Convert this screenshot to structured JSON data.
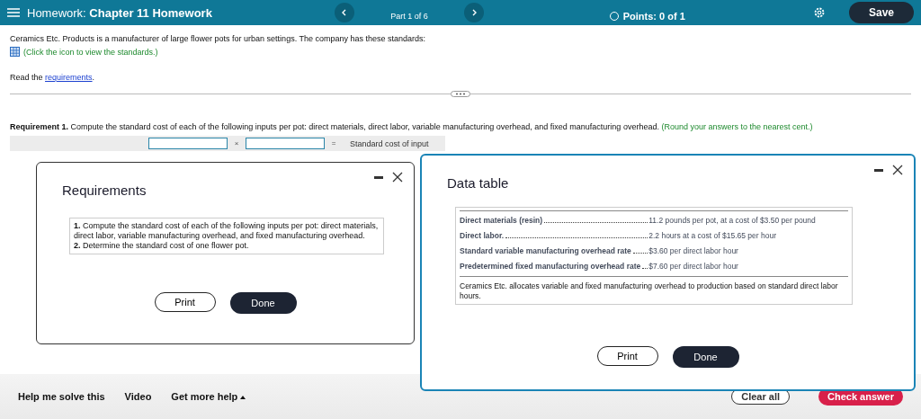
{
  "header": {
    "title_prefix": "Homework:",
    "title": "Chapter 11 Homework",
    "part": "Part 1 of 6",
    "points": "Points: 0 of 1",
    "save": "Save"
  },
  "intro": {
    "text": "Ceramics Etc. Products is a manufacturer of large flower pots for urban settings. The company has these standards:",
    "hint": "(Click the icon to view the standards.)",
    "read_before": "Read the ",
    "read_link": "requirements",
    "read_after": "."
  },
  "requirement": {
    "text": "**Requirement 1.** Compute the standard cost of each of the following inputs per pot: direct materials, direct labor, variable manufacturing overhead, and fixed manufacturing overhead.",
    "hint": "(Round your answers to the nearest cent.)",
    "times": "×",
    "equals": "=",
    "result_label": "Standard cost of input"
  },
  "requirements_dialog": {
    "title": "Requirements",
    "items": [
      "**1.** Compute the standard cost of each of the following inputs per pot: direct materials, direct labor, variable manufacturing overhead, and fixed manufacturing overhead.",
      "**2.** Determine the standard cost of one flower pot."
    ],
    "print": "Print",
    "done": "Done"
  },
  "data_dialog": {
    "title": "Data table",
    "rows": [
      {
        "label": "Direct materials (resin)",
        "value": "11.2 pounds per pot, at a cost of $3.50 per pound"
      },
      {
        "label": "Direct labor.",
        "value": "2.2 hours at a cost of $15.65 per hour"
      },
      {
        "label": "Standard variable manufacturing overhead rate",
        "value": "$3.60 per direct labor hour"
      },
      {
        "label": "Predetermined fixed manufacturing overhead rate",
        "value": "$7.60 per direct labor hour"
      }
    ],
    "note": "Ceramics Etc. allocates variable and fixed manufacturing overhead to production based on standard direct labor hours.",
    "print": "Print",
    "done": "Done"
  },
  "footer": {
    "help": "Help me solve this",
    "video": "Video",
    "more": "Get more help",
    "clear": "Clear all",
    "check": "Check answer"
  }
}
